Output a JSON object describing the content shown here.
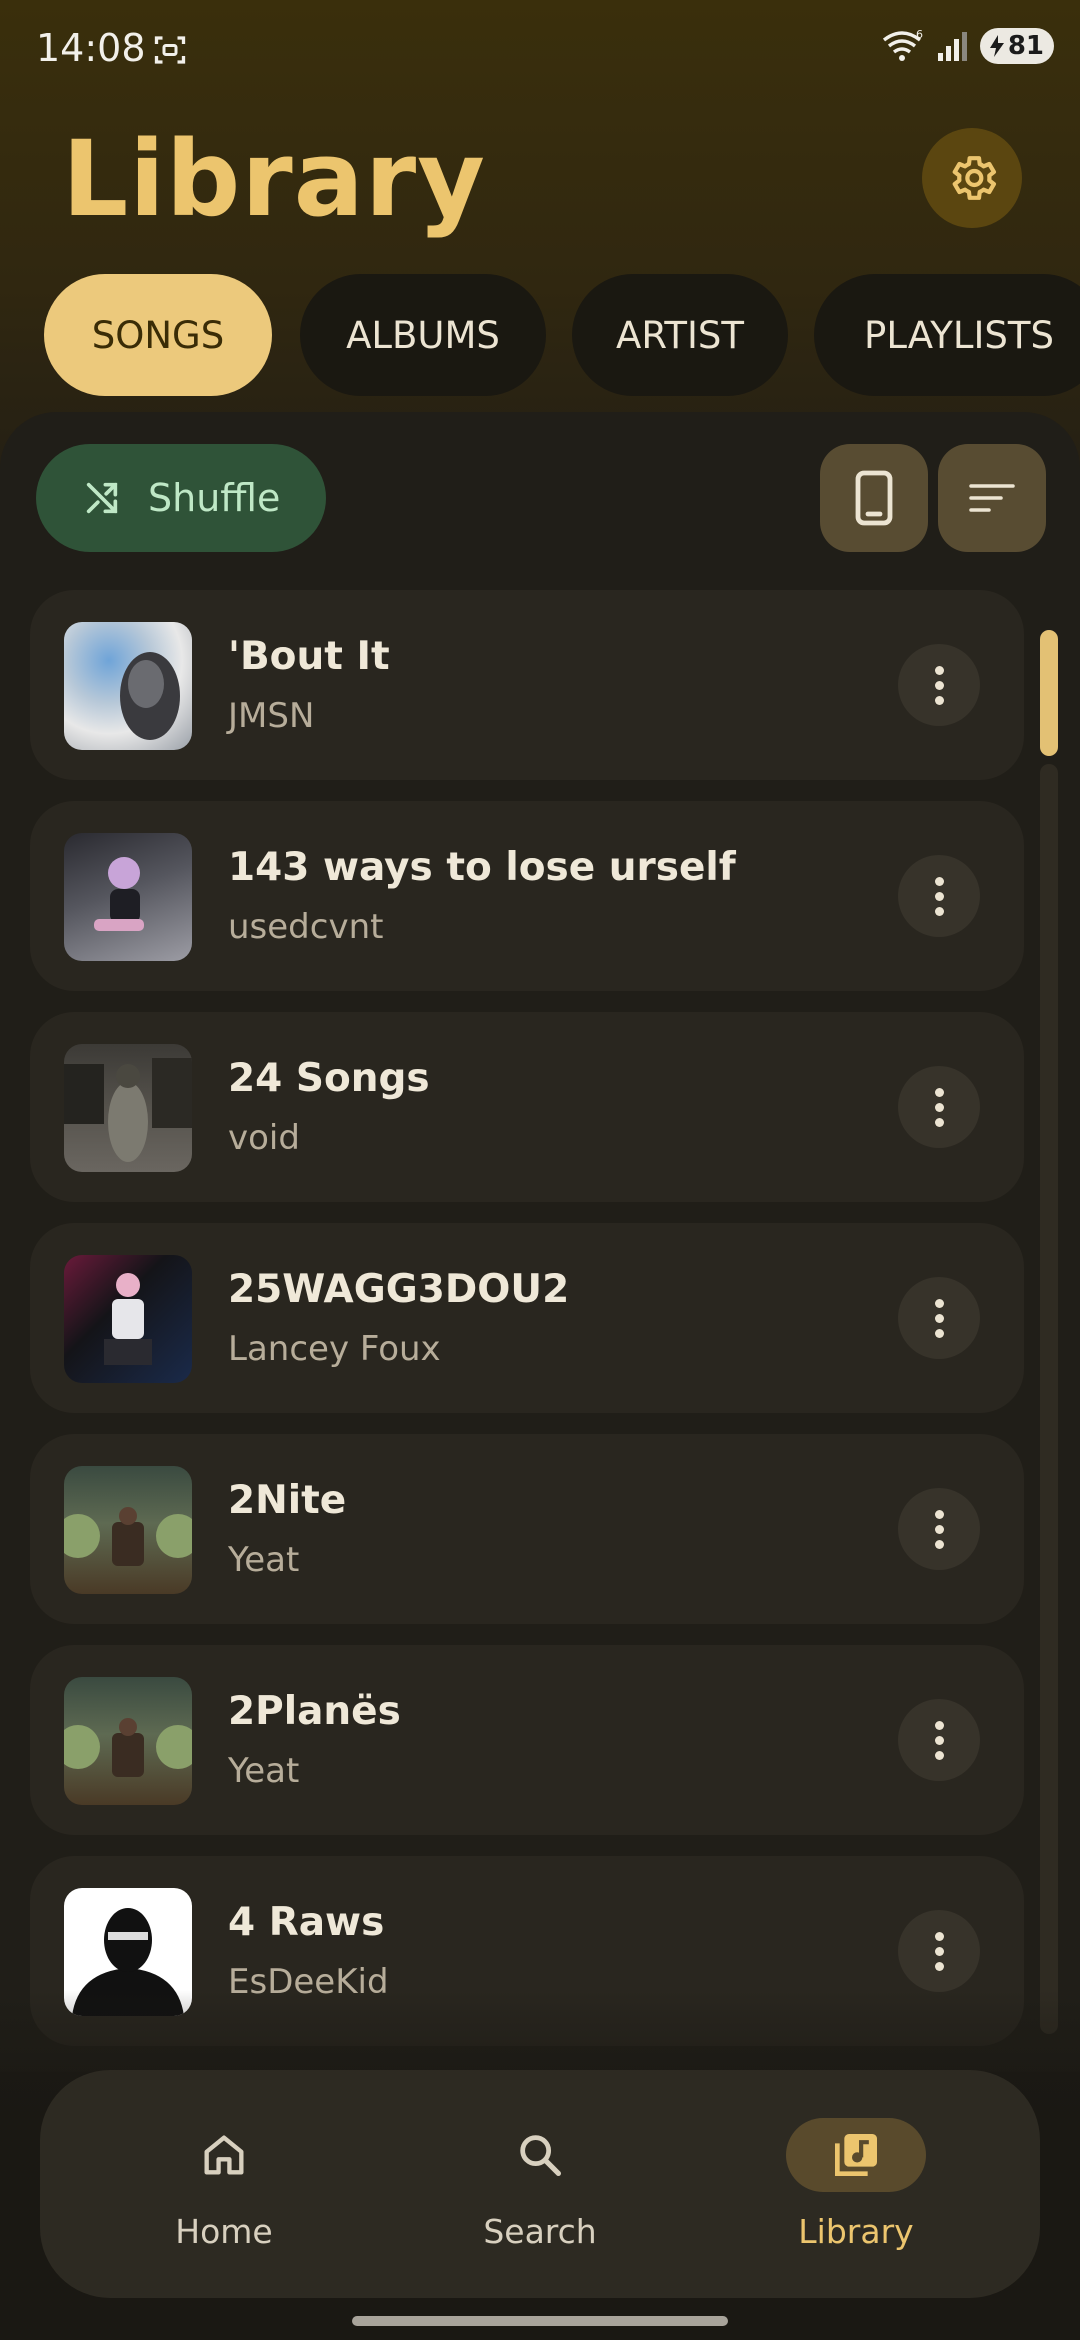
{
  "status_bar": {
    "time": "14:08",
    "wifi_badge": "6",
    "battery_level": "81",
    "icons": [
      "screenshot-icon",
      "wifi-icon",
      "signal-icon",
      "battery-charging-icon"
    ]
  },
  "header": {
    "title": "Library",
    "settings_icon": "gear-icon"
  },
  "tabs": [
    {
      "label": "SONGS",
      "active": true
    },
    {
      "label": "ALBUMS",
      "active": false
    },
    {
      "label": "ARTIST",
      "active": false
    },
    {
      "label": "PLAYLISTS",
      "active": false
    }
  ],
  "toolbar": {
    "shuffle_label": "Shuffle",
    "shuffle_icon": "shuffle-icon",
    "device_icon": "phone-icon",
    "sort_icon": "sort-icon"
  },
  "songs": [
    {
      "title": "'Bout It",
      "artist": "JMSN"
    },
    {
      "title": "143 ways to lose urself",
      "artist": "usedcvnt"
    },
    {
      "title": "24 Songs",
      "artist": "void"
    },
    {
      "title": "25WAGG3DOU2",
      "artist": "Lancey Foux"
    },
    {
      "title": "2Nite",
      "artist": "Yeat"
    },
    {
      "title": "2Planës",
      "artist": "Yeat"
    },
    {
      "title": "4 Raws",
      "artist": "EsDeeKid"
    }
  ],
  "nav": [
    {
      "label": "Home",
      "icon": "home-icon",
      "active": false
    },
    {
      "label": "Search",
      "icon": "search-icon",
      "active": false
    },
    {
      "label": "Library",
      "icon": "library-music-icon",
      "active": true
    }
  ],
  "colors": {
    "accent": "#ecc56e",
    "shuffle_bg": "#2f5338",
    "panel_bg": "#201e18"
  }
}
